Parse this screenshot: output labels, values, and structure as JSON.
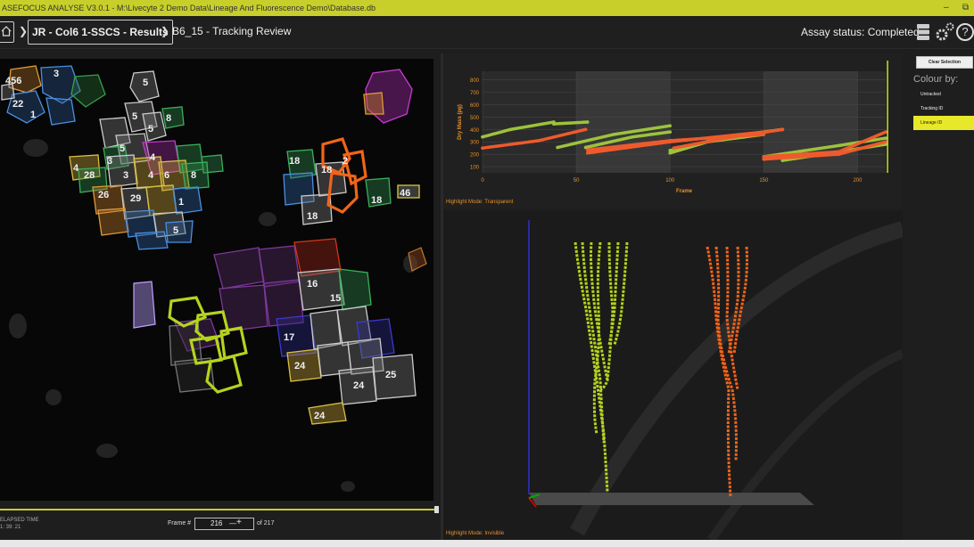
{
  "window": {
    "title": "ASEFOCUS ANALYSE V3.0.1 - M:\\Livecyte 2 Demo Data\\Lineage And Fluorescence Demo\\Database.db",
    "min_glyph": "–",
    "restore_glyph": "⧉"
  },
  "nav": {
    "chevron": "❯",
    "crumb1": "JR - Col6 1-SSCS - Results",
    "crumb2": "B6_15 - Tracking Review",
    "assay_status": "Assay status: Completed",
    "help_glyph": "?"
  },
  "left_panel": {
    "cell_labels": [
      "456",
      "5",
      "3",
      "22",
      "1",
      "5",
      "5",
      "8",
      "5",
      "4",
      "3",
      "4",
      "28",
      "26",
      "3",
      "4",
      "29",
      "6",
      "8",
      "1",
      "5",
      "18",
      "18",
      "2",
      "18",
      "46",
      "18",
      "16",
      "15",
      "17",
      "24",
      "24",
      "25",
      "24"
    ],
    "frame_label": "Frame #",
    "frame_value": "216",
    "frame_minus": "—",
    "frame_plus": "+",
    "frame_total": "of 217",
    "time_label": "ELAPSED TIME",
    "time_value": "1: 39: 21"
  },
  "chart": {
    "highlight_label": "Highlight Mode:",
    "highlight_value": "Transparent"
  },
  "chart_data": {
    "type": "scatter",
    "xlabel": "Frame",
    "ylabel": "Dry Mass (pg)",
    "xlim": [
      0,
      215
    ],
    "ylim": [
      50,
      870
    ],
    "x_ticks": [
      0,
      50,
      100,
      150,
      200
    ],
    "y_ticks": [
      100,
      200,
      300,
      400,
      500,
      600,
      700,
      800
    ],
    "grid": true,
    "highlight_frame": 216,
    "series": [
      {
        "color": "#9dc33b",
        "segments": [
          [
            [
              0,
              340
            ],
            [
              15,
              400
            ],
            [
              38,
              460
            ]
          ],
          [
            [
              38,
              445
            ],
            [
              56,
              460
            ]
          ],
          [
            [
              40,
              255
            ],
            [
              70,
              360
            ],
            [
              100,
              430
            ]
          ],
          [
            [
              55,
              255
            ],
            [
              80,
              340
            ],
            [
              100,
              380
            ]
          ],
          [
            [
              100,
              230
            ],
            [
              130,
              340
            ],
            [
              160,
              400
            ]
          ],
          [
            [
              100,
              210
            ],
            [
              120,
              300
            ],
            [
              150,
              360
            ]
          ],
          [
            [
              150,
              180
            ],
            [
              190,
              270
            ],
            [
              215,
              330
            ]
          ],
          [
            [
              160,
              150
            ],
            [
              190,
              220
            ],
            [
              215,
              280
            ]
          ]
        ]
      },
      {
        "color": "#ef5a2c",
        "segments": [
          [
            [
              0,
              250
            ],
            [
              30,
              310
            ],
            [
              55,
              400
            ]
          ],
          [
            [
              56,
              210
            ],
            [
              100,
              300
            ],
            [
              150,
              380
            ]
          ],
          [
            [
              56,
              235
            ],
            [
              100,
              310
            ],
            [
              150,
              360
            ]
          ],
          [
            [
              102,
              250
            ],
            [
              130,
              330
            ],
            [
              160,
              400
            ]
          ],
          [
            [
              150,
              180
            ],
            [
              190,
              220
            ],
            [
              215,
              380
            ]
          ],
          [
            [
              150,
              160
            ],
            [
              190,
              200
            ],
            [
              215,
              300
            ]
          ]
        ]
      }
    ]
  },
  "viewer3d": {
    "highlight_label": "Highlight Mode:",
    "highlight_value": "Invisible"
  },
  "right_panel": {
    "clear_button": "Clear Selection",
    "colour_by": "Colour by:",
    "options": [
      "Untracked",
      "Tracking ID",
      "Lineage ID"
    ],
    "selected": "Lineage ID"
  },
  "colors": {
    "accent": "#c8cf2a",
    "lineage_green": "#b5d31e",
    "lineage_orange": "#f26419",
    "selection_yellow": "#e8e82a",
    "label_orange": "#e8912d"
  }
}
